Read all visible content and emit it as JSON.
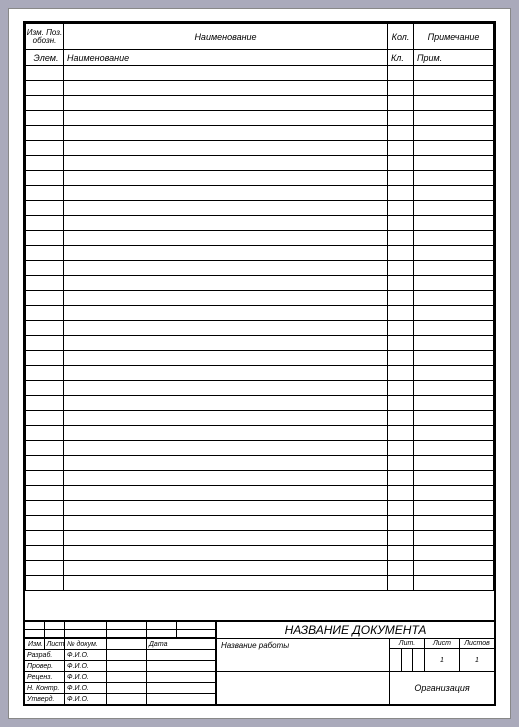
{
  "header": {
    "col1": "Изм. Поз. обозн.",
    "col2": "Наименование",
    "col3": "Кол.",
    "col4": "Примечание"
  },
  "subheader": {
    "col1": "Элем.",
    "col2": "Наименование",
    "col3": "Кл.",
    "col4": "Прим."
  },
  "title_block": {
    "doc_title": "НАЗВАНИЕ ДОКУМЕНТА",
    "work_title": "Название работы",
    "stamp_header": {
      "izm": "Изм.",
      "list": "Лист",
      "ndoc": "№ докум.",
      "sign": "",
      "date": "Дата"
    },
    "signatures": [
      {
        "role": "Разраб.",
        "name": "Ф.И.О."
      },
      {
        "role": "Провер.",
        "name": "Ф.И.О."
      },
      {
        "role": "Реценз.",
        "name": "Ф.И.О."
      },
      {
        "role": "Н. Контр.",
        "name": "Ф.И.О."
      },
      {
        "role": "Утверд.",
        "name": "Ф.И.О."
      }
    ],
    "lit": {
      "h1": "Лит.",
      "h2": "Лист",
      "h3": "Листов",
      "v2": "1",
      "v3": "1"
    },
    "organization": "Организация"
  }
}
